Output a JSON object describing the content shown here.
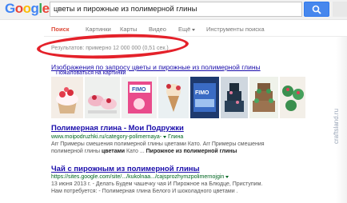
{
  "header": {
    "logo": {
      "g1": "G",
      "o1": "o",
      "o2": "o",
      "g2": "g",
      "l": "l",
      "e": "e"
    },
    "query": "цветы и пирожные из полимерной глины"
  },
  "tabs": [
    {
      "label": "Поиск",
      "active": true
    },
    {
      "label": "Картинки"
    },
    {
      "label": "Карты"
    },
    {
      "label": "Видео"
    },
    {
      "label": "Ещё"
    },
    {
      "label": "Инструменты поиска"
    }
  ],
  "stats": "Результатов: примерно 12 000 000 (0,51 сек.)",
  "image_result": {
    "title": "Изображения по запросу цветы и пирожные из полимерной глины",
    "subtitle": "Пожаловаться на картинки"
  },
  "results": [
    {
      "title": "Полимерная глина - Мои Подружки",
      "url": "www.moipodruzhki.ru/category-polimernaya-",
      "url_suffix": "Глина",
      "snippet1": "Arr Примеры смешения полимерной глины цветами Като. Arr Примеры смешения",
      "snippet2_pre": "полимерной глины ",
      "snippet2_bold": "цветами",
      "snippet2_mid": " Като ... ",
      "snippet2_bold2": "Пирожное из полимерной глины"
    },
    {
      "title": "Чай с пирожным из полимерной глины",
      "url": "https://sites.google.com/site/.../kukolnaa.../cajsprozhymzpolimernojgin",
      "date": "13 июня 2013 г.",
      "snippet1": "- Делать Будем чашечку чая И Пирожное на Блюдце, Приступим.",
      "snippet2": "Нам потребуется: - Полимерная глина Белого И шоколадного цветами ."
    }
  ],
  "watermark": "craftsland.ru",
  "colors": {
    "link": "#1a0dab",
    "url": "#006621",
    "active_tab": "#dd4b39",
    "search_button": "#4787ed",
    "highlight_ring": "#e4212a"
  },
  "icons": [
    "mic-icon",
    "search-icon"
  ]
}
